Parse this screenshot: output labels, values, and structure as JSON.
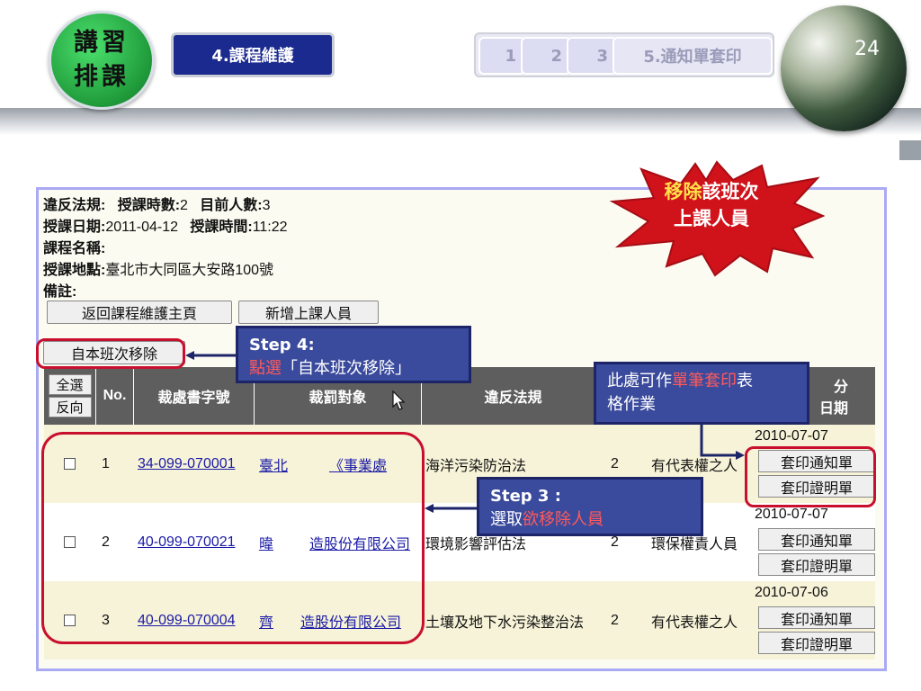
{
  "badge": {
    "line1": "講習",
    "line2": "排課"
  },
  "section_tab": "4.課程維護",
  "step_nav": {
    "steps": [
      "1",
      "2",
      "3"
    ],
    "current": "5.通知單套印"
  },
  "page_number": "24",
  "starburst": {
    "highlight": "移除",
    "line1_rest": "該班次",
    "line2": "上課人員"
  },
  "info": {
    "line1_label_a": "違反法規:",
    "line1_label_b": "授課時數:",
    "line1_val_b": "2",
    "line1_label_c": "目前人數:",
    "line1_val_c": "3",
    "line2_label_a": "授課日期:",
    "line2_val_a": "2011-04-12",
    "line2_label_b": "授課時間:",
    "line2_val_b": "11:22",
    "line3_label": "課程名稱:",
    "line4_label": "授課地點:",
    "line4_val": "臺北市大同區大安路100號",
    "line5_label": "備註:"
  },
  "buttons": {
    "back": "返回課程維護主頁",
    "add": "新增上課人員",
    "remove": "自本班次移除"
  },
  "callouts": {
    "step4_title": "Step 4:",
    "step4_red": "點選",
    "step4_text": "「自本班次移除」",
    "print_pre": "此處可作",
    "print_red": "單筆套印",
    "print_post": "表",
    "print_line2": "格作業",
    "step3_title": "Step 3 :",
    "step3_pre": "選取",
    "step3_red": "欲移除人員"
  },
  "table": {
    "select_all": "全選",
    "invert": "反向",
    "headers": {
      "no": "No.",
      "doc": "裁處書字號",
      "target": "裁罰對象",
      "law": "違反法規",
      "right_top": "分",
      "right_bottom": "日期"
    },
    "rows": [
      {
        "no": "1",
        "doc": "34-099-070001",
        "target": "臺北",
        "target_b": "《事業處",
        "law": "海洋污染防治法",
        "hours": "2",
        "role": "有代表權之人",
        "date": "2010-07-07"
      },
      {
        "no": "2",
        "doc": "40-099-070021",
        "target": "暐",
        "target_b": "造股份有限公司",
        "law": "環境影響評估法",
        "hours": "2",
        "role": "環保權責人員",
        "date": "2010-07-07"
      },
      {
        "no": "3",
        "doc": "40-099-070004",
        "target": "齊",
        "target_b": "造股份有限公司",
        "law": "土壤及地下水污染整治法",
        "hours": "2",
        "role": "有代表權之人",
        "date": "2010-07-06"
      }
    ],
    "print_notice": "套印通知單",
    "print_certificate": "套印證明單"
  },
  "colors": {
    "callout_bg": "#3a4a9c",
    "highlight_red": "#c8102e",
    "header_gray": "#5e5e5e"
  }
}
